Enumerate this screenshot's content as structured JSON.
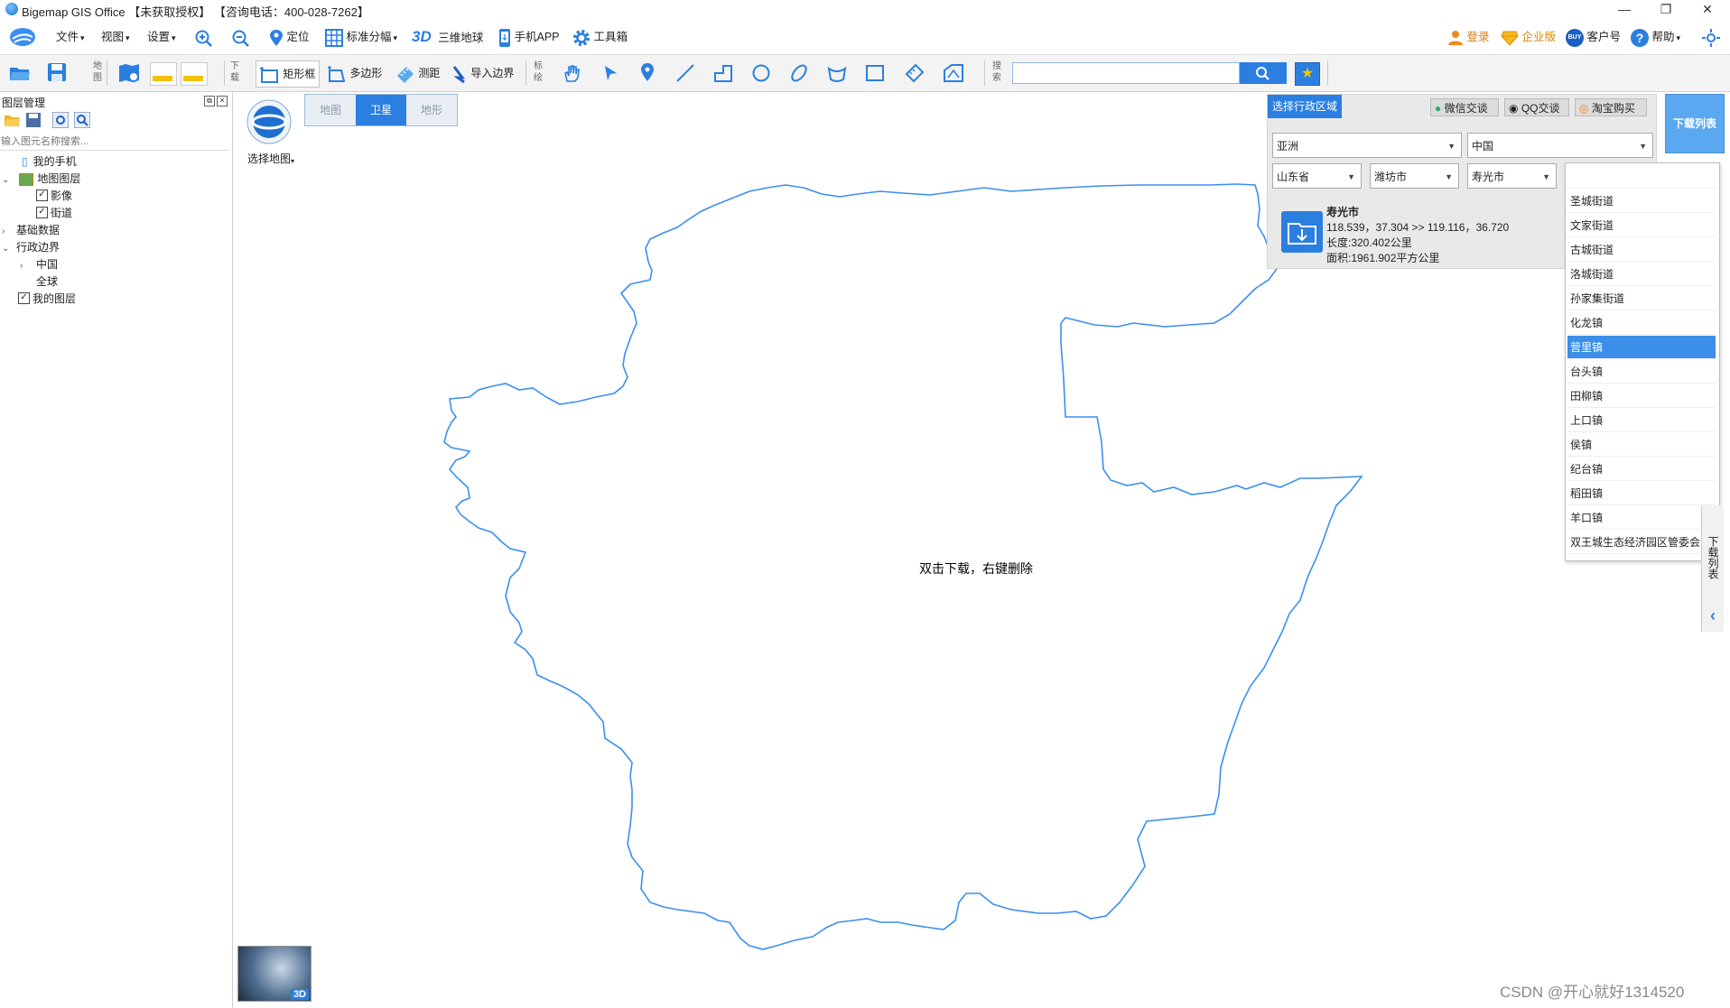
{
  "window": {
    "title": "Bigemap GIS Office 【未获取授权】  【咨询电话：400-028-7262】",
    "controls": [
      "—",
      "❐",
      "✕"
    ]
  },
  "menu": {
    "file": "文件",
    "view": "视图",
    "settings": "设置",
    "locate": "定位",
    "std_sheet": "标准分幅",
    "three_d": "3D",
    "globe": "三维地球",
    "mobile_app": "手机APP",
    "toolbox": "工具箱",
    "login": "登录",
    "enterprise": "企业版",
    "buy": "BUY",
    "customer_id": "客户号",
    "help": "帮助"
  },
  "toolbar2": {
    "map_label": "地图",
    "download_label": "下载",
    "rect": "矩形框",
    "polygon": "多边形",
    "measure": "测距",
    "import_boundary": "导入边界",
    "mark_label": "标绘",
    "search_label": "搜索",
    "search_value": ""
  },
  "layer_panel": {
    "title": "图层管理",
    "search_placeholder": "输入图元名称搜索...",
    "tree": {
      "my_phone": "我的手机",
      "map_layers": "地图图层",
      "imagery": "影像",
      "streets": "街道",
      "basic_data": "基础数据",
      "admin_boundary": "行政边界",
      "china": "中国",
      "global": "全球",
      "my_layers": "我的图层"
    }
  },
  "map": {
    "selector_label": "选择地图",
    "tabs": [
      "地图",
      "卫星",
      "地形"
    ],
    "active_tab": "卫星",
    "center_hint": "双击下载，右键删除",
    "globe_badge": "3D",
    "boundary_color": "#3a8ff0"
  },
  "region": {
    "header": "选择行政区域",
    "wechat": "微信交谈",
    "qq": "QQ交谈",
    "taobao": "淘宝购买",
    "continent": "亚洲",
    "country": "中国",
    "province": "山东省",
    "city": "潍坊市",
    "county": "寿光市",
    "download_list": "下载列表",
    "info": {
      "name": "寿光市",
      "coords": "118.539，37.304 >> 119.116，36.720",
      "length": "长度:320.402公里",
      "area": "面积:1961.902平方公里"
    },
    "dropdown": [
      "",
      "圣城街道",
      "文家街道",
      "古城街道",
      "洛城街道",
      "孙家集街道",
      "化龙镇",
      "营里镇",
      "台头镇",
      "田柳镇",
      "上口镇",
      "侯镇",
      "纪台镇",
      "稻田镇",
      "羊口镇",
      "双王城生态经济园区管委会"
    ],
    "dropdown_selected": "营里镇"
  },
  "side_tab": "下载列表",
  "watermark": "CSDN @开心就好1314520"
}
